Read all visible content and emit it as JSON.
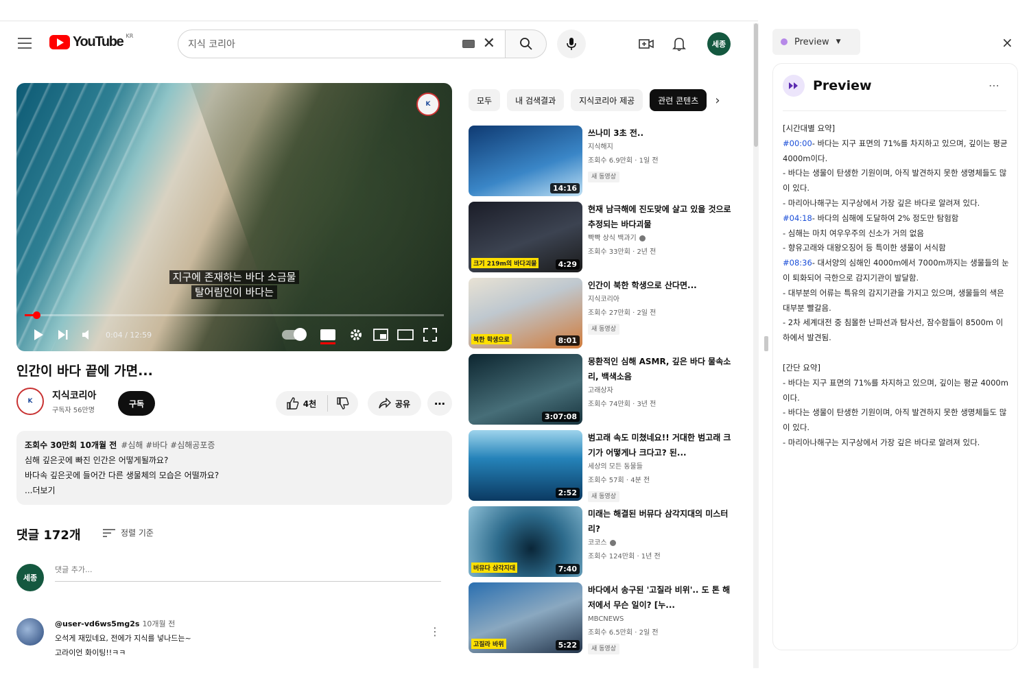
{
  "header": {
    "logo_text": "YouTube",
    "logo_region": "KR",
    "search_value": "지식 코리아",
    "clear_glyph": "✕",
    "avatar_text": "세종",
    "icons": [
      "menu-icon",
      "search-icon",
      "mic-icon",
      "create-icon",
      "bell-icon"
    ]
  },
  "player": {
    "channel_watermark": "K",
    "caption_line1": "지구에 존재하는 바다 소금물",
    "caption_line2": "탈어림인이 바다는",
    "time": "0:04 / 12:59",
    "progress": 0.03
  },
  "video": {
    "title": "인간이 바다 끝에 가면...",
    "channel_name": "지식코리아",
    "channel_avatar_text": "K",
    "subscribers": "구독자 56만명",
    "subscribe_label": "구독",
    "likes": "4천",
    "share_label": "공유",
    "more_glyph": "⋯"
  },
  "description": {
    "meta": "조회수 30만회  10개월 전",
    "tags": "#심해 #바다 #심해공포증",
    "line2": "심해 깊은곳에 빠진 인간은 어떻게될까요?",
    "line3": "바다속 깊은곳에 들어간 다른 생물체의 모습은 어떨까요?",
    "more": "...더보기"
  },
  "comments": {
    "count_label": "댓글 172개",
    "sort_label": "정렬 기준",
    "my_avatar_text": "세종",
    "add_placeholder": "댓글 추가...",
    "first": {
      "user": "@user-vd6ws5mg2s",
      "time": "10개월 전",
      "line1": "오석게 재밌네요, 전에가 지식를 넣나드는~",
      "line2": "고라이언 화이팅!!ㅋㅋ"
    }
  },
  "chips": [
    "모두",
    "내 검색결과",
    "지식코리아 제공",
    "관련 콘텐츠"
  ],
  "related": [
    {
      "title": "쓰나미 3초 전..",
      "channel": "지식해지",
      "stats": "조회수 6.9만회 · 1일 전",
      "badge": "새 동영상",
      "duration": "14:16",
      "thumb_class": "t1",
      "verified": false,
      "overlay": ""
    },
    {
      "title": "현재 남극해에 진도맞에 살고 있을 것으로 추정되는 바다괴물",
      "channel": "빡빡 상식 백과기",
      "stats": "조회수 33만회 · 2년 전",
      "badge": "",
      "duration": "4:29",
      "thumb_class": "t2",
      "verified": true,
      "overlay": "크기 219m의 바다괴물"
    },
    {
      "title": "인간이 북한 학생으로 산다면...",
      "channel": "지식코리아",
      "stats": "조회수 27만회 · 2일 전",
      "badge": "새 동영상",
      "duration": "8:01",
      "thumb_class": "t3",
      "verified": false,
      "overlay": "북한 학생으로"
    },
    {
      "title": "몽환적인 심해 ASMR, 깊은 바다 물속소리, 백색소음",
      "channel": "고래상자",
      "stats": "조회수 74만회 · 3년 전",
      "badge": "",
      "duration": "3:07:08",
      "thumb_class": "t4",
      "verified": false,
      "overlay": ""
    },
    {
      "title": "범고래 속도 미쳤네요!! 거대한 범고래 크기가 어떻게나 크다고? 된...",
      "channel": "세상의 모든 동물들",
      "stats": "조회수 57회 · 4분 전",
      "badge": "새 동영상",
      "duration": "2:52",
      "thumb_class": "t5",
      "verified": false,
      "overlay": ""
    },
    {
      "title": "미래는 해결된 버뮤다 삼각지대의 미스터리?",
      "channel": "코코스",
      "stats": "조회수 124만회 · 1년 전",
      "badge": "",
      "duration": "7:40",
      "thumb_class": "t6",
      "verified": true,
      "overlay": "버뮤다 삼각지대"
    },
    {
      "title": "바다에서 송구된 '고질라 비위'.. 도 톤 해저에서 무슨 일이? [누...",
      "channel": "MBCNEWS",
      "stats": "조회수 6.5만회 · 2일 전",
      "badge": "새 동영상",
      "duration": "5:22",
      "thumb_class": "t7",
      "verified": false,
      "overlay": "고질라 바위"
    }
  ],
  "panel": {
    "tab_label": "Preview",
    "close_glyph": "×",
    "title": "Preview",
    "more_glyph": "⋯",
    "section1_heading": "[시간대별 요약]",
    "s1": [
      {
        "ts": "#00:00",
        "text": "- 바다는 지구 표면의 71%를 차지하고 있으며, 깊이는 평균 4000m이다."
      },
      {
        "ts": "",
        "text": "- 바다는 생물이 탄생한 기원이며, 아직 발견하지 못한 생명체들도 많이 있다."
      },
      {
        "ts": "",
        "text": "- 마리아나해구는 지구상에서 가장 깊은 바다로 알려져 있다."
      },
      {
        "ts": "#04:18",
        "text": "- 바다의 심해에 도달하여 2% 정도만 탐험함"
      },
      {
        "ts": "",
        "text": "- 심해는 마치 여우우주의 신소가 거의 없음"
      },
      {
        "ts": "",
        "text": "- 향유고래와 대왕오징어 등 특이한 생물이 서식함"
      },
      {
        "ts": "#08:36",
        "text": "- 대서양의 심해인 4000m에서 7000m까지는 생물들의 눈이 퇴화되어 극한으로 감지기관이 발달함."
      },
      {
        "ts": "",
        "text": "- 대부분의 어류는 특유의 감지기관을 가지고 있으며, 생물들의 색은 대부분 빨갈음."
      },
      {
        "ts": "",
        "text": "- 2차 세계대전 중 침몰한 난파선과 탐사선, 잠수함들이 8500m 이하에서 발견됨."
      }
    ],
    "section2_heading": "[간단 요약]",
    "s2": [
      "- 바다는 지구 표면의 71%를 차지하고 있으며, 깊이는 평균 4000m이다.",
      "- 바다는 생물이 탄생한 기원이며, 아직 발견하지 못한 생명체들도 많이 있다.",
      "- 마리아나해구는 지구상에서 가장 깊은 바다로 알려져 있다."
    ]
  },
  "colors": {
    "brand_red": "#ff0000",
    "avatar_green": "#14583f",
    "link_blue": "#1a4ed8",
    "chip_bg": "#f2f2f2"
  }
}
